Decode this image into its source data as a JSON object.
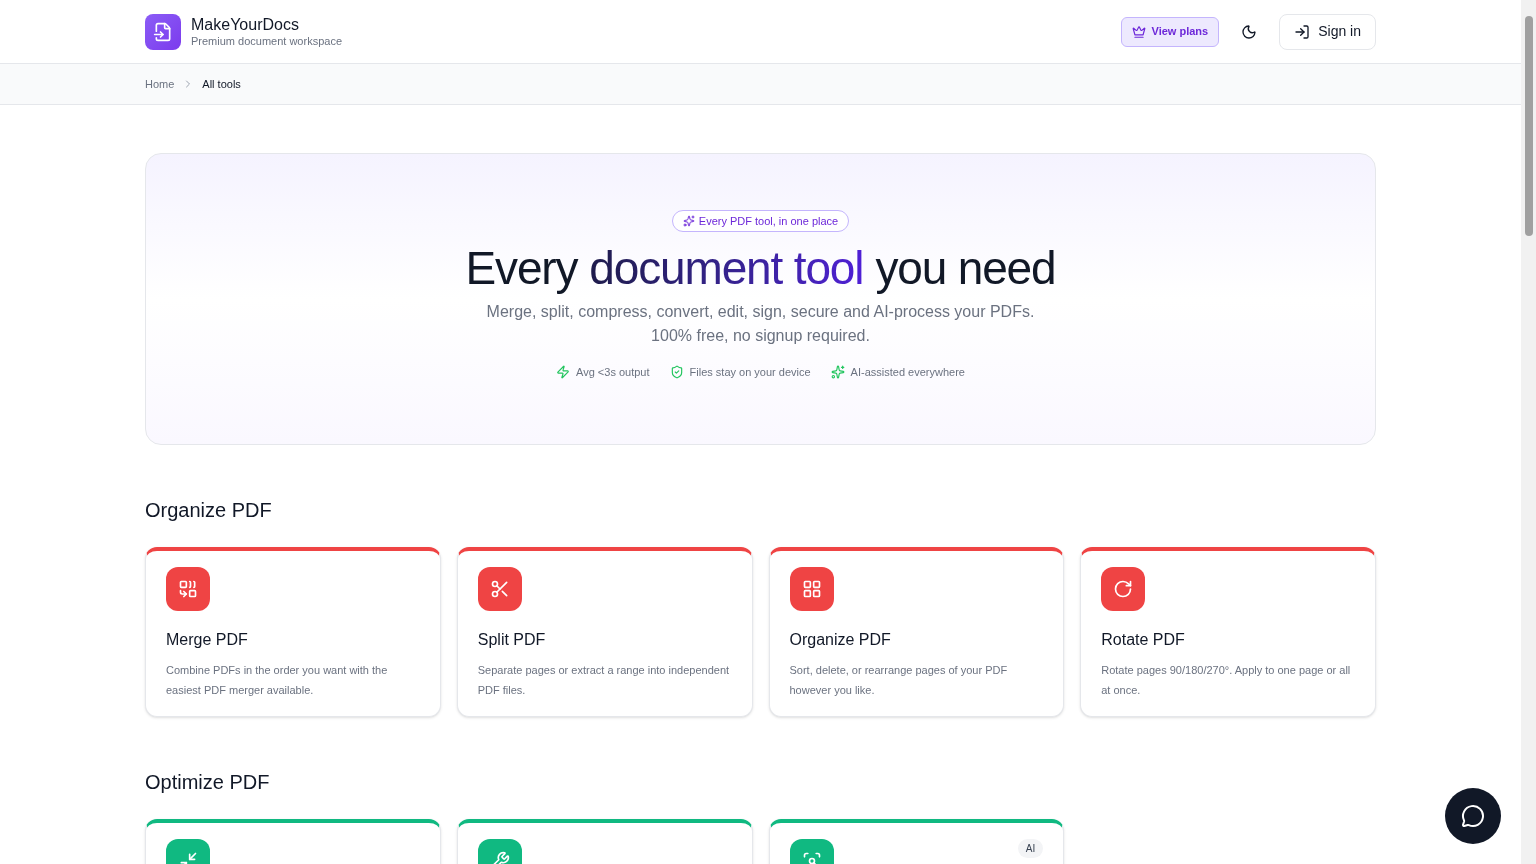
{
  "header": {
    "brand": "MakeYourDocs",
    "tagline": "Premium document workspace",
    "plans_button": "View plans",
    "sign_in_button": "Sign in"
  },
  "breadcrumb": [
    "Home",
    "All tools"
  ],
  "hero": {
    "badge": "Every PDF tool, in one place",
    "title_parts": [
      {
        "text": "Every",
        "kind": "plain"
      },
      {
        "text": "document tool",
        "kind": "accent"
      },
      {
        "text": "you need",
        "kind": "plain"
      }
    ],
    "subtitle": "Merge, split, compress, convert, edit, sign, secure and AI-process your PDFs. 100% free, no signup required.",
    "features": [
      {
        "kind": "bolt",
        "text": "Avg <3s output"
      },
      {
        "kind": "shield",
        "text": "Files stay on your device"
      },
      {
        "kind": "sparkle",
        "text": "AI-assisted everywhere"
      }
    ]
  },
  "sections": [
    {
      "title": "Organize PDF",
      "color": "#ef4444",
      "tools": [
        {
          "kind": "merge",
          "name": "Merge PDF",
          "description": "Combine PDFs in the order you want with the easiest PDF merger available."
        },
        {
          "kind": "scissors",
          "name": "Split PDF",
          "description": "Separate pages or extract a range into independent PDF files."
        },
        {
          "kind": "grid",
          "name": "Organize PDF",
          "description": "Sort, delete, or rearrange pages of your PDF however you like."
        },
        {
          "kind": "rotate",
          "name": "Rotate PDF",
          "description": "Rotate pages 90/180/270°. Apply to one page or all at once."
        }
      ]
    },
    {
      "title": "Optimize PDF",
      "color": "#10b981",
      "tools": [
        {
          "kind": "compress"
        },
        {
          "kind": "wrench"
        },
        {
          "kind": "scan",
          "badge": "AI"
        }
      ]
    }
  ]
}
